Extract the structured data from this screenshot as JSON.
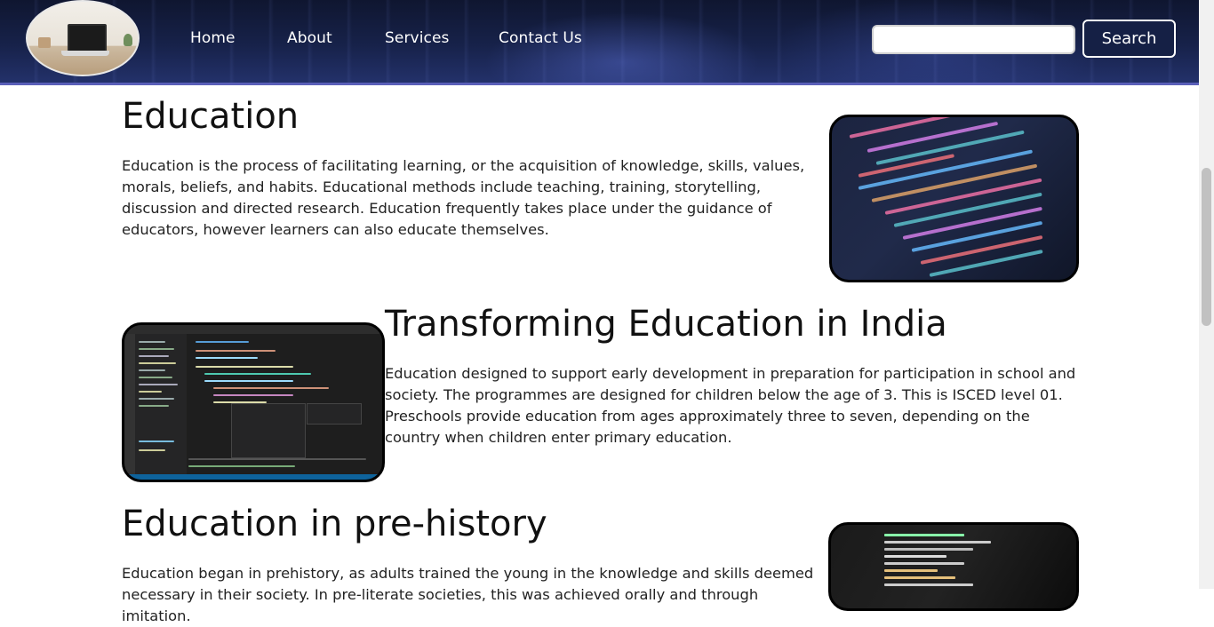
{
  "header": {
    "nav": [
      "Home",
      "About",
      "Services",
      "Contact Us"
    ],
    "search_placeholder": "",
    "search_button": "Search"
  },
  "sections": [
    {
      "title": "Education",
      "text": "Education is the process of facilitating learning, or the acquisition of knowledge, skills, values, morals, beliefs, and habits. Educational methods include teaching, training, storytelling, discussion and directed research. Education frequently takes place under the guidance of educators, however learners can also educate themselves."
    },
    {
      "title": "Transforming Education in India",
      "text": "Education designed to support early development in preparation for participation in school and society. The programmes are designed for children below the age of 3. This is ISCED level 01. Preschools provide education from ages approximately three to seven, depending on the country when children enter primary education."
    },
    {
      "title": "Education in pre-history",
      "text": "Education began in prehistory, as adults trained the young in the knowledge and skills deemed necessary in their society. In pre-literate societies, this was achieved orally and through imitation."
    }
  ],
  "colors": {
    "header_bg": "#17224a",
    "accent_border": "#5a5fb8",
    "button_bg": "#152045"
  }
}
